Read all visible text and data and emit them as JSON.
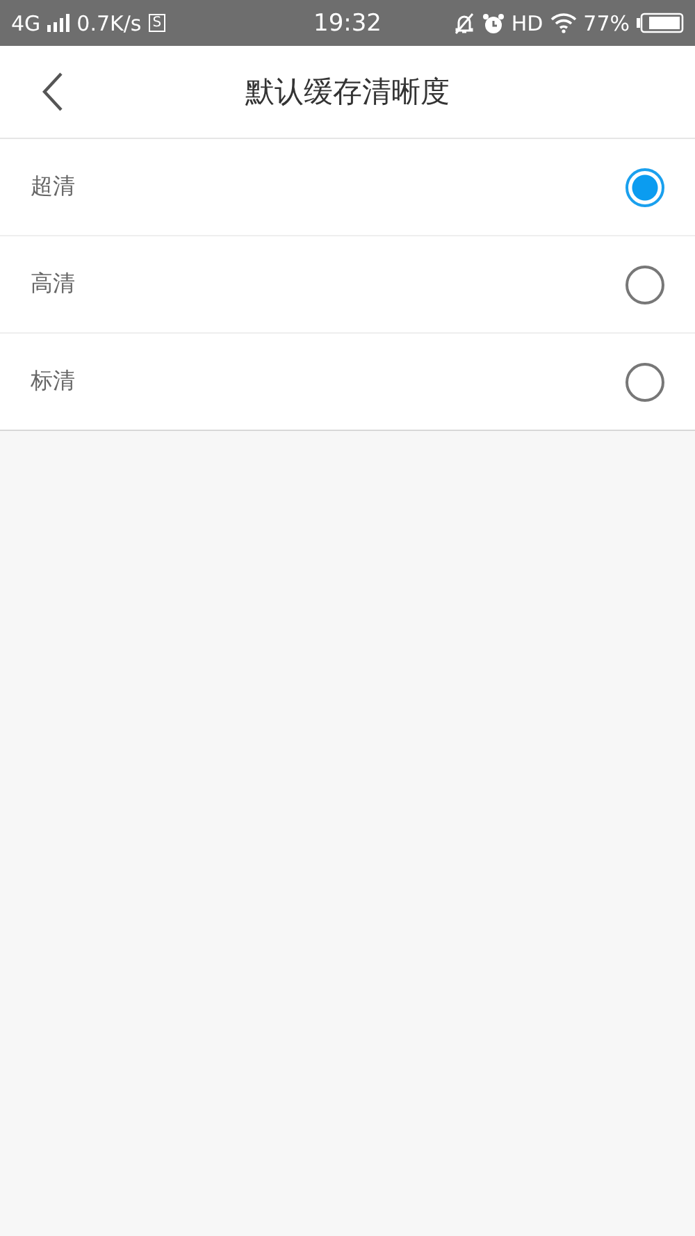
{
  "status_bar": {
    "network": "4G",
    "speed": "0.7K/s",
    "app_badge": "S",
    "time": "19:32",
    "hd": "HD",
    "battery": "77%"
  },
  "header": {
    "title": "默认缓存清晰度"
  },
  "options": [
    {
      "label": "超清",
      "selected": true
    },
    {
      "label": "高清",
      "selected": false
    },
    {
      "label": "标清",
      "selected": false
    }
  ]
}
